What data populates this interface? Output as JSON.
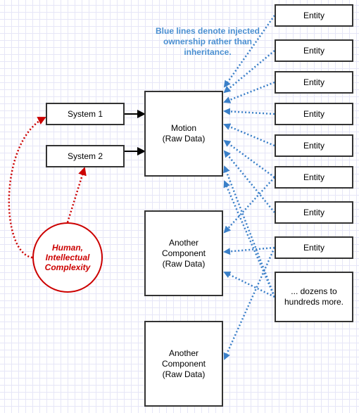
{
  "note": "Blue lines denote injected ownership rather than inheritance.",
  "colors": {
    "ownership_line": "#3a7fc8",
    "human_accent": "#cc0000",
    "box_border": "#333333",
    "grid": "#e6e6f7"
  },
  "systems": [
    {
      "label": "System 1"
    },
    {
      "label": "System 2"
    }
  ],
  "components": [
    {
      "label": "Motion\n(Raw Data)"
    },
    {
      "label": "Another\nComponent\n(Raw Data)"
    },
    {
      "label": "Another\nComponent\n(Raw Data)"
    }
  ],
  "entities": [
    {
      "label": "Entity"
    },
    {
      "label": "Entity"
    },
    {
      "label": "Entity"
    },
    {
      "label": "Entity"
    },
    {
      "label": "Entity"
    },
    {
      "label": "Entity"
    },
    {
      "label": "Entity"
    },
    {
      "label": "Entity"
    },
    {
      "label": "... dozens to\nhundreds more."
    }
  ],
  "human": {
    "label": "Human,\nIntellectual\nComplexity"
  },
  "edges": {
    "system_to_component": [
      {
        "from": "System 1",
        "to": "Motion"
      },
      {
        "from": "System 2",
        "to": "Motion"
      }
    ],
    "human_to_system": [
      {
        "from": "Human, Intellectual Complexity",
        "to": "System 1"
      },
      {
        "from": "Human, Intellectual Complexity",
        "to": "System 2"
      }
    ],
    "ownership": [
      {
        "from_entity": 0,
        "to_component": 0
      },
      {
        "from_entity": 1,
        "to_component": 0
      },
      {
        "from_entity": 2,
        "to_component": 0
      },
      {
        "from_entity": 3,
        "to_component": 0
      },
      {
        "from_entity": 4,
        "to_component": 0
      },
      {
        "from_entity": 5,
        "to_component": 0
      },
      {
        "from_entity": 6,
        "to_component": 0
      },
      {
        "from_entity": 8,
        "to_component": 0
      },
      {
        "from_entity": 8,
        "to_component": 0
      },
      {
        "from_entity": 5,
        "to_component": 1
      },
      {
        "from_entity": 7,
        "to_component": 1
      },
      {
        "from_entity": 8,
        "to_component": 1
      },
      {
        "from_entity": 7,
        "to_component": 2
      }
    ]
  }
}
